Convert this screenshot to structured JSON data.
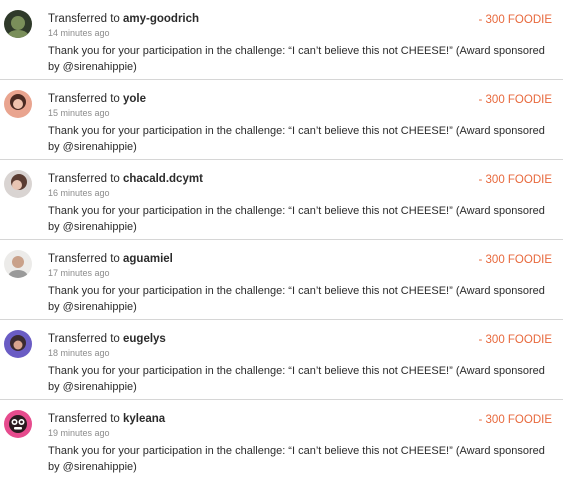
{
  "transfers": [
    {
      "prefix": "Transferred to",
      "user": "amy-goodrich",
      "time": "14 minutes ago",
      "message": "Thank you for your participation in the challenge: “I can’t believe this not CHEESE!” (Award sponsored by @sirenahippie)",
      "amount": "- 300 FOODIE",
      "avatar_colors": [
        "#2f3a2a",
        "#7a8f5a"
      ]
    },
    {
      "prefix": "Transferred to",
      "user": "yole",
      "time": "15 minutes ago",
      "message": "Thank you for your participation in the challenge: “I can’t believe this not CHEESE!” (Award sponsored by @sirenahippie)",
      "amount": "- 300 FOODIE",
      "avatar_colors": [
        "#e9a48f",
        "#4a2a22"
      ]
    },
    {
      "prefix": "Transferred to",
      "user": "chacald.dcymt",
      "time": "16 minutes ago",
      "message": "Thank you for your participation in the challenge: “I can’t believe this not CHEESE!” (Award sponsored by @sirenahippie)",
      "amount": "- 300 FOODIE",
      "avatar_colors": [
        "#d9d4d2",
        "#5a3c32"
      ]
    },
    {
      "prefix": "Transferred to",
      "user": "aguamiel",
      "time": "17 minutes ago",
      "message": "Thank you for your participation in the challenge: “I can’t believe this not CHEESE!” (Award sponsored by @sirenahippie)",
      "amount": "- 300 FOODIE",
      "avatar_colors": [
        "#ecebe9",
        "#c9a18a"
      ]
    },
    {
      "prefix": "Transferred to",
      "user": "eugelys",
      "time": "18 minutes ago",
      "message": "Thank you for your participation in the challenge: “I can’t believe this not CHEESE!” (Award sponsored by @sirenahippie)",
      "amount": "- 300 FOODIE",
      "avatar_colors": [
        "#6a5cc4",
        "#3a2a30"
      ]
    },
    {
      "prefix": "Transferred to",
      "user": "kyleana",
      "time": "19 minutes ago",
      "message": "Thank you for your participation in the challenge: “I can’t believe this not CHEESE!” (Award sponsored by @sirenahippie)",
      "amount": "- 300 FOODIE",
      "avatar_colors": [
        "#e64b8d",
        "#2a1a20"
      ]
    }
  ],
  "colors": {
    "amount": "#e8683c",
    "divider": "#d6d6d6",
    "muted": "#8b8b8b"
  }
}
